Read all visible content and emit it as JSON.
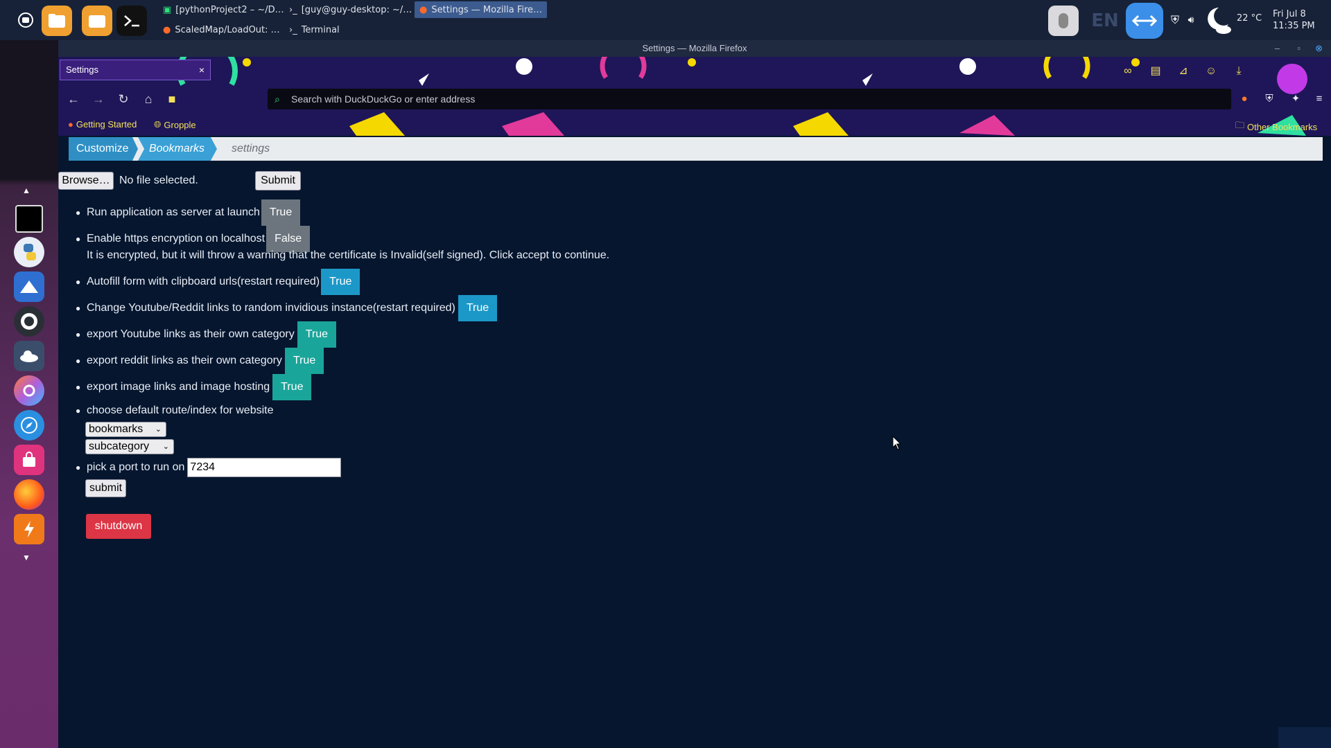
{
  "taskbar": {
    "tasks": [
      {
        "label": "[pythonProject2 – ~/D…"
      },
      {
        "label": "[guy@guy-desktop: ~/…"
      },
      {
        "label": "Settings — Mozilla Fire…"
      },
      {
        "label": "ScaledMap/LoadOut: …"
      },
      {
        "label": "Terminal"
      }
    ],
    "lang": "EN",
    "temperature": "22 °C",
    "date": "Fri Jul 8",
    "time": "11:35 PM"
  },
  "window": {
    "title": "Settings — Mozilla Firefox"
  },
  "browser": {
    "tab_title": "Settings",
    "url_placeholder": "Search with DuckDuckGo or enter address",
    "bookmarks": [
      "Getting Started",
      "Gropple"
    ],
    "other_bookmarks": "Other Bookmarks"
  },
  "breadcrumb": {
    "items": [
      "Customize",
      "Bookmarks",
      "settings"
    ]
  },
  "upload": {
    "browse_label": "Browse…",
    "file_status": "No file selected.",
    "submit_label": "Submit"
  },
  "settings": [
    {
      "label": "Run application as server at launch",
      "value": "True",
      "style": "grey"
    },
    {
      "label": "Enable https encryption on localhost",
      "value": "False",
      "style": "grey"
    },
    {
      "label": "Autofill form with clipboard urls(restart required)",
      "value": "True",
      "style": "blue"
    },
    {
      "label": "Change Youtube/Reddit links to random invidious instance(restart required)",
      "value": "True",
      "style": "blue"
    },
    {
      "label": "export Youtube links as their own category",
      "value": "True",
      "style": "teal"
    },
    {
      "label": "export reddit links as their own category",
      "value": "True",
      "style": "teal"
    },
    {
      "label": "export image links and image hosting",
      "value": "True",
      "style": "teal"
    }
  ],
  "https_note": "It is encrypted, but it will throw a warning that the certificate is Invalid(self signed). Click accept to continue.",
  "route": {
    "label": "choose default route/index for website",
    "select_route": "bookmarks",
    "select_sub": "subcategory"
  },
  "port": {
    "label": "pick a port to run on",
    "value": "7234",
    "submit_label": "submit"
  },
  "shutdown_label": "shutdown",
  "colors": {
    "page_bg": "#06162f",
    "toggle_grey": "#6c757d",
    "toggle_blue": "#1c98c8",
    "toggle_teal": "#1aa59a",
    "shutdown": "#dc3545"
  }
}
